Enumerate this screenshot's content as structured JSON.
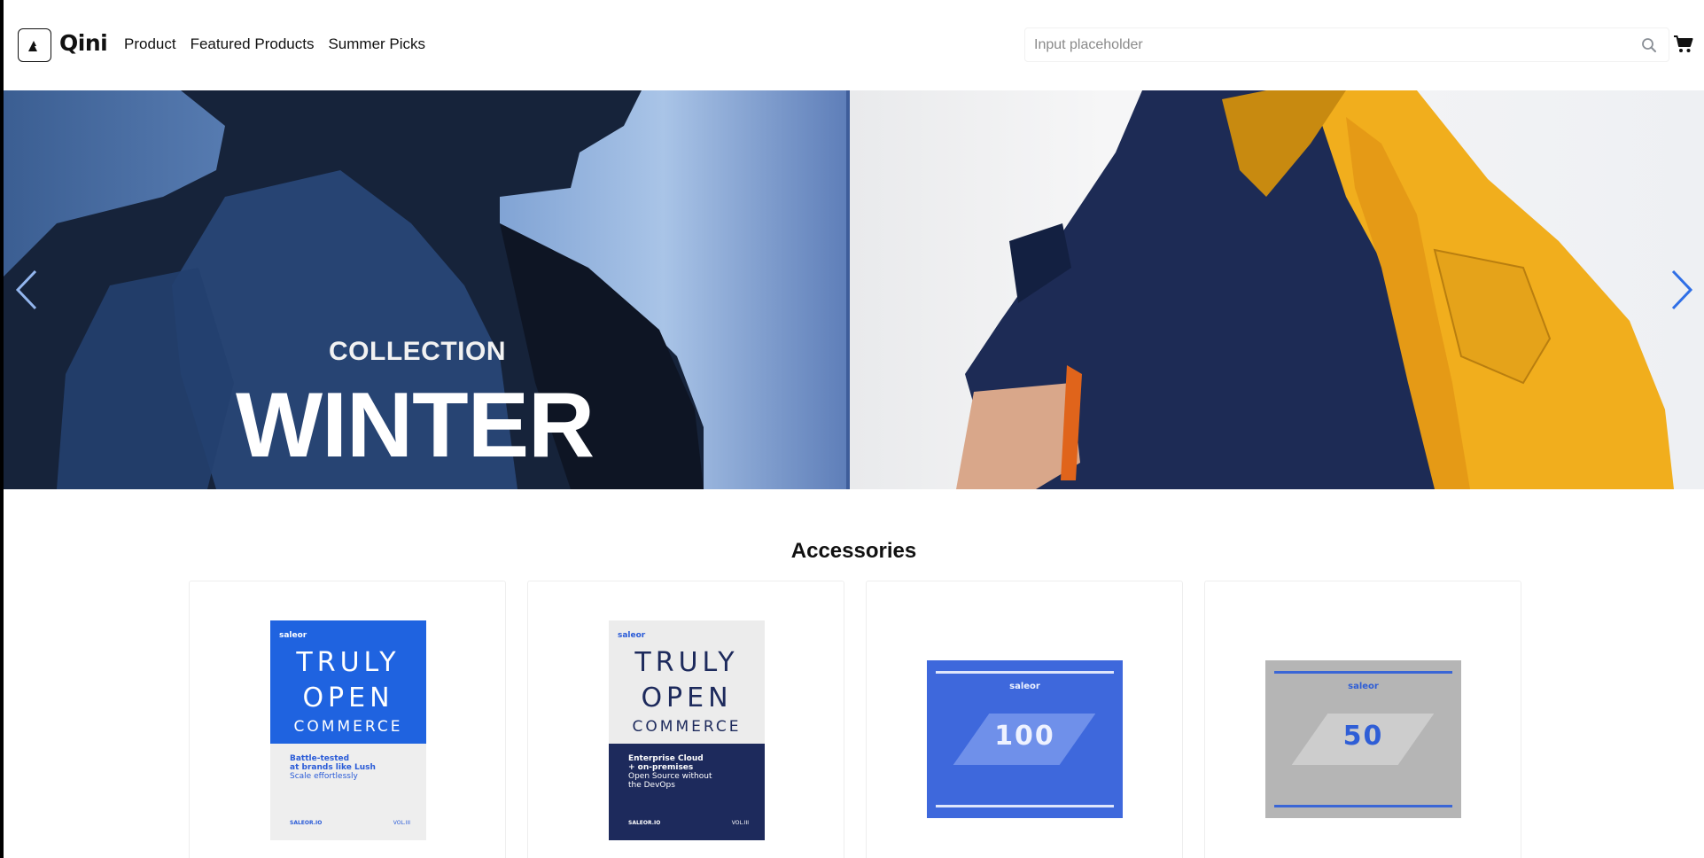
{
  "header": {
    "brand": "Qini",
    "nav": [
      "Product",
      "Featured Products",
      "Summer Picks"
    ],
    "search_placeholder": "Input placeholder"
  },
  "hero": {
    "line1": "COLLECTION",
    "line2": "WINTER"
  },
  "section": {
    "title": "Accessories"
  },
  "products": [
    {
      "kind": "book",
      "brand": "saleor",
      "title_1": "TRULY",
      "title_2": "OPEN",
      "title_3": "COMMERCE",
      "body": [
        "Battle-tested",
        "at brands like Lush",
        "Scale effortlessly"
      ],
      "footer": "SALEOR.IO",
      "volume": "VOL.III",
      "colors": {
        "top": "#1f63e0",
        "top_text": "#ffffff",
        "bottom": "#eeeeee",
        "bottom_text": "#2a5bd7"
      }
    },
    {
      "kind": "book",
      "brand": "saleor",
      "title_1": "TRULY",
      "title_2": "OPEN",
      "title_3": "COMMERCE",
      "body": [
        "Enterprise Cloud",
        "+ on-premises",
        "Open Source without",
        "the DevOps"
      ],
      "footer": "SALEOR.IO",
      "volume": "VOL.III",
      "colors": {
        "top": "#ececec",
        "top_text": "#1d2a5c",
        "bottom": "#1d2a5c",
        "bottom_text": "#ffffff"
      }
    },
    {
      "kind": "gift",
      "brand": "saleor",
      "amount": "100",
      "colors": {
        "bg": "#3e68dc",
        "line": "#dfe6fb",
        "diamond": "#6f90ea",
        "num": "#eef2ff"
      }
    },
    {
      "kind": "gift",
      "brand": "saleor",
      "amount": "50",
      "colors": {
        "bg": "#b5b5b5",
        "line": "#3a66d6",
        "diamond": "#cdcdcd",
        "num": "#2f5ed6"
      }
    }
  ],
  "icons": {
    "logo": "triangle-logo-icon",
    "search": "search-icon",
    "cart": "cart-icon",
    "prev": "chevron-left-icon",
    "next": "chevron-right-icon"
  }
}
